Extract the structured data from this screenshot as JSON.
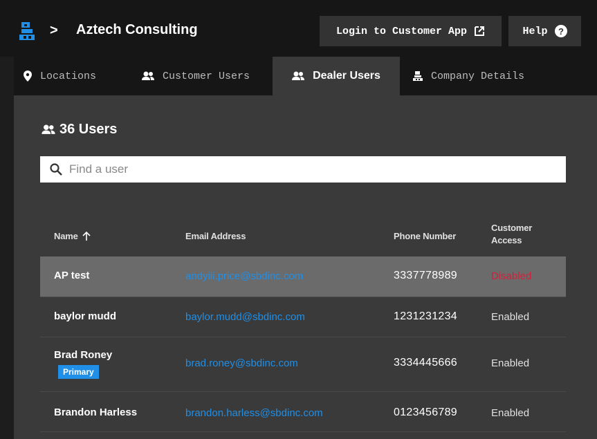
{
  "header": {
    "company": "Aztech Consulting",
    "breadcrumb_sep": ">",
    "login_button": "Login to Customer App",
    "help_button": "Help"
  },
  "tabs": [
    {
      "label": "Locations",
      "icon": "location-pin-icon",
      "active": false
    },
    {
      "label": "Customer Users",
      "icon": "users-icon",
      "active": false
    },
    {
      "label": "Dealer Users",
      "icon": "users-icon",
      "active": true
    },
    {
      "label": "Company Details",
      "icon": "building-icon",
      "active": false
    }
  ],
  "users_count": "36 Users",
  "search": {
    "placeholder": "Find a user",
    "value": ""
  },
  "table": {
    "headers": {
      "name": "Name",
      "email": "Email Address",
      "phone": "Phone Number",
      "access_line1": "Customer",
      "access_line2": "Access"
    },
    "rows": [
      {
        "name": "AP test",
        "email": "andyiii.price@sbdinc.com",
        "phone": "3337778989",
        "access": "Disabled",
        "badge": ""
      },
      {
        "name": "baylor mudd",
        "email": "baylor.mudd@sbdinc.com",
        "phone": "1231231234",
        "access": "Enabled",
        "badge": ""
      },
      {
        "name": "Brad Roney",
        "email": "brad.roney@sbdinc.com",
        "phone": "3334445666",
        "access": "Enabled",
        "badge": "Primary"
      },
      {
        "name": "Brandon Harless",
        "email": "brandon.harless@sbdinc.com",
        "phone": "0123456789",
        "access": "Enabled",
        "badge": ""
      }
    ]
  },
  "colors": {
    "accent": "#1f8fe8",
    "disabled": "#d0223b",
    "header_bg": "#161616",
    "panel_bg": "#3a3a3a"
  }
}
